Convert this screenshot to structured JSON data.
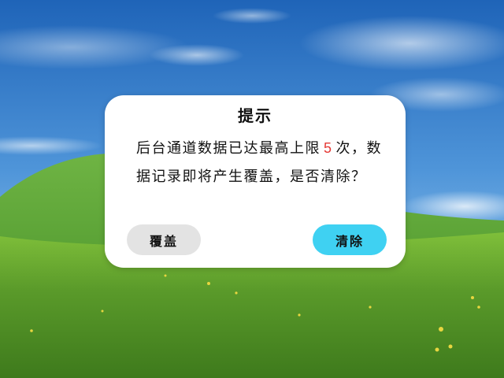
{
  "colors": {
    "count_highlight": "#e53935",
    "overwrite_button_bg": "#e3e3e3",
    "clear_button_bg": "#3fd1f2",
    "dialog_bg": "#ffffff"
  },
  "dialog": {
    "title": "提示",
    "message_before": "后台通道数据已达最高上限",
    "limit_count": "5",
    "message_after": "次，数据记录即将产生覆盖，是否清除？",
    "overwrite_label": "覆盖",
    "clear_label": "清除"
  }
}
